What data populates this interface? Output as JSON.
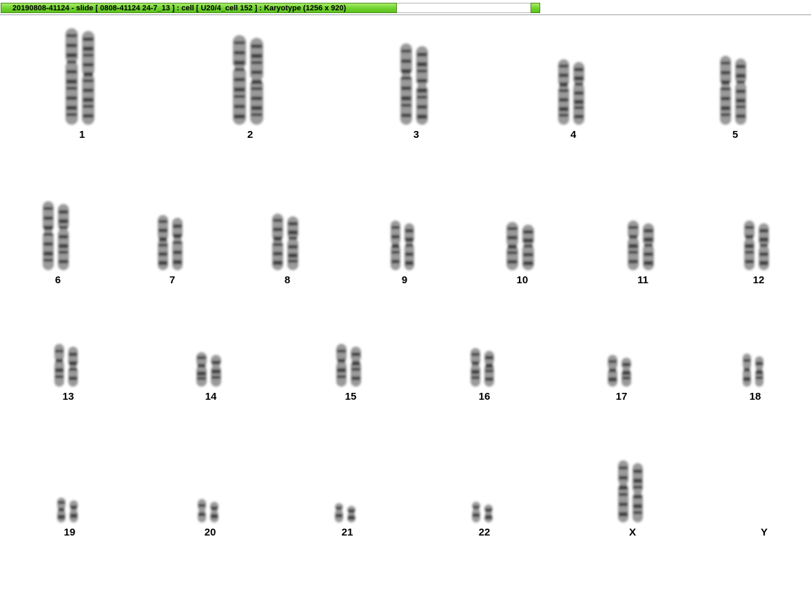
{
  "window": {
    "title": "20190808-41124 - slide [ 0808-41124 24-7_13 ] : cell [ U20/4_cell 152 ] : Karyotype  (1256 x 920)"
  },
  "karyotype": {
    "chromosomes": [
      {
        "label": "1"
      },
      {
        "label": "2"
      },
      {
        "label": "3"
      },
      {
        "label": "4"
      },
      {
        "label": "5"
      },
      {
        "label": "6"
      },
      {
        "label": "7"
      },
      {
        "label": "8"
      },
      {
        "label": "9"
      },
      {
        "label": "10"
      },
      {
        "label": "11"
      },
      {
        "label": "12"
      },
      {
        "label": "13"
      },
      {
        "label": "14"
      },
      {
        "label": "15"
      },
      {
        "label": "16"
      },
      {
        "label": "17"
      },
      {
        "label": "18"
      },
      {
        "label": "19"
      },
      {
        "label": "20"
      },
      {
        "label": "21"
      },
      {
        "label": "22"
      },
      {
        "label": "X"
      },
      {
        "label": "Y"
      }
    ]
  },
  "colors": {
    "title_green": "#6fd12e",
    "chromosome_dark": "#1e1e1e",
    "chromosome_light": "#9a9a9a"
  }
}
